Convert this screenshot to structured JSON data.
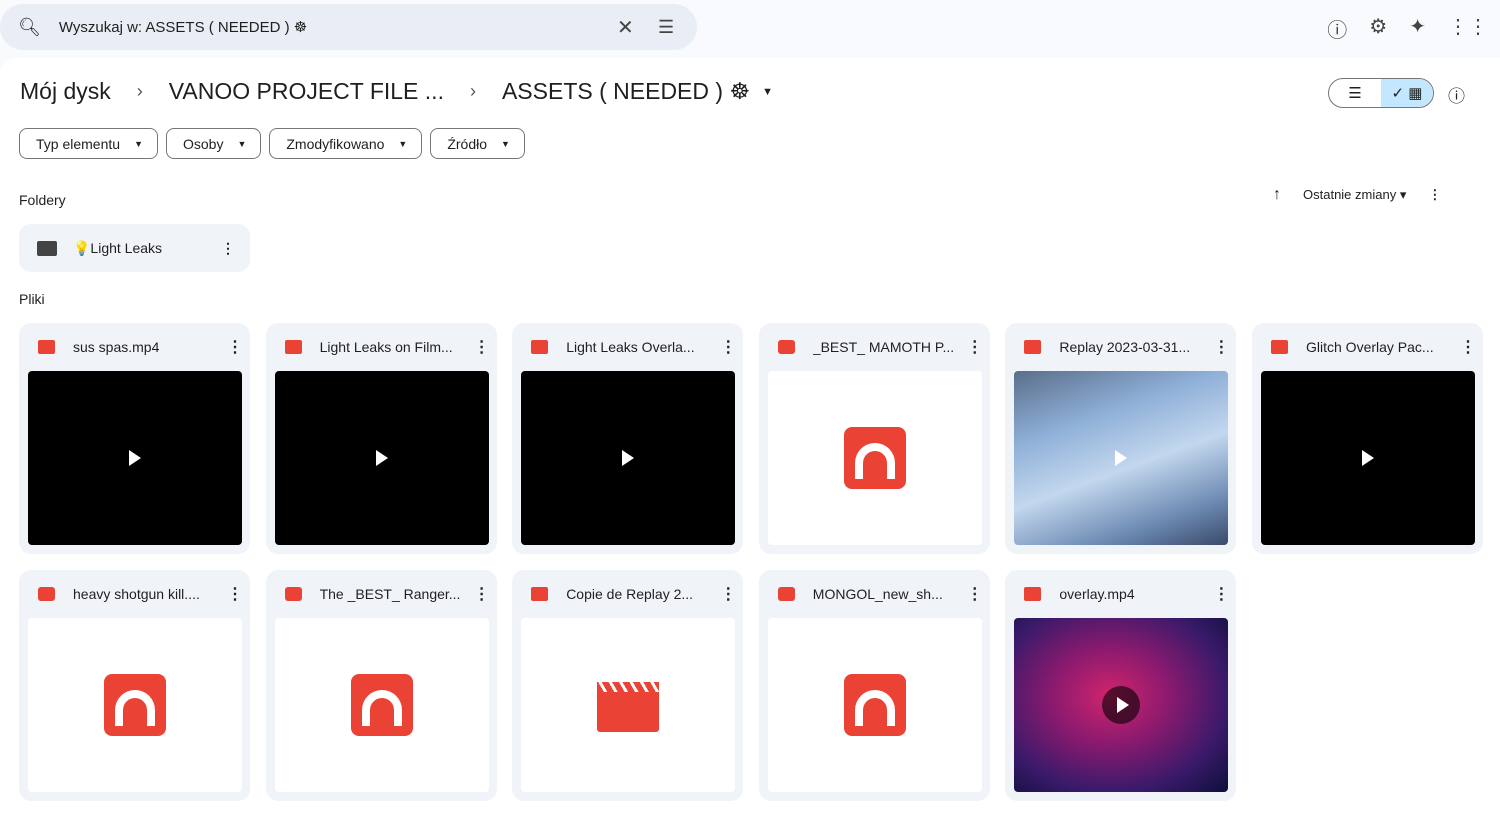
{
  "search": {
    "value": "Wyszukaj w: ASSETS ( NEEDED ) ☸",
    "clear_icon": "close-icon",
    "options_icon": "tune-icon"
  },
  "top_icons": [
    "help-icon",
    "settings-icon",
    "gemini-icon",
    "apps-icon"
  ],
  "breadcrumb": [
    "Mój dysk",
    "VANOO PROJECT FILE ...",
    "ASSETS ( NEEDED ) ☸"
  ],
  "filters": [
    "Typ elementu",
    "Osoby",
    "Zmodyfikowano",
    "Źródło"
  ],
  "sections": {
    "folders": "Foldery",
    "files": "Pliki"
  },
  "sort": {
    "label": "Ostatnie zmiany"
  },
  "folders": [
    {
      "name": "💡Light Leaks"
    }
  ],
  "files": [
    {
      "name": "sus spas.mp4",
      "type": "video",
      "thumb": "black"
    },
    {
      "name": "Light Leaks on Film...",
      "type": "video",
      "thumb": "black"
    },
    {
      "name": "Light Leaks Overla...",
      "type": "video",
      "thumb": "black"
    },
    {
      "name": "_BEST_ MAMOTH P...",
      "type": "audio",
      "thumb": "audio"
    },
    {
      "name": "Replay 2023-03-31...",
      "type": "video",
      "thumb": "replay"
    },
    {
      "name": "Glitch Overlay Pac...",
      "type": "video",
      "thumb": "black"
    },
    {
      "name": "heavy shotgun kill....",
      "type": "audio",
      "thumb": "audio"
    },
    {
      "name": "The _BEST_ Ranger...",
      "type": "audio",
      "thumb": "audio"
    },
    {
      "name": "Copie de Replay 2...",
      "type": "video",
      "thumb": "videoicon"
    },
    {
      "name": "MONGOL_new_sh...",
      "type": "audio",
      "thumb": "audio"
    },
    {
      "name": "overlay.mp4",
      "type": "video",
      "thumb": "overlay"
    }
  ]
}
